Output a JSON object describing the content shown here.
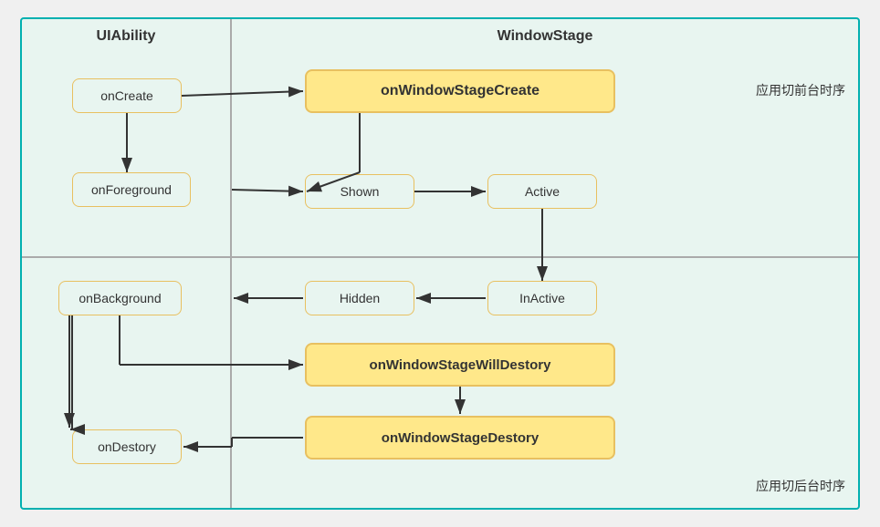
{
  "diagram": {
    "title_left": "UIAbility",
    "title_right": "WindowStage",
    "label_top_right": "应用切前台时序",
    "label_bottom_right": "应用切后台时序",
    "nodes": {
      "onCreate": "onCreate",
      "onForeground": "onForeground",
      "onBackground": "onBackground",
      "onDestory": "onDestory",
      "onWindowStageCreate": "onWindowStageCreate",
      "shown": "Shown",
      "active": "Active",
      "inactive": "InActive",
      "hidden": "Hidden",
      "onWindowStageWillDestory": "onWindowStageWillDestory",
      "onWindowStageDestory": "onWindowStageDestory"
    }
  }
}
